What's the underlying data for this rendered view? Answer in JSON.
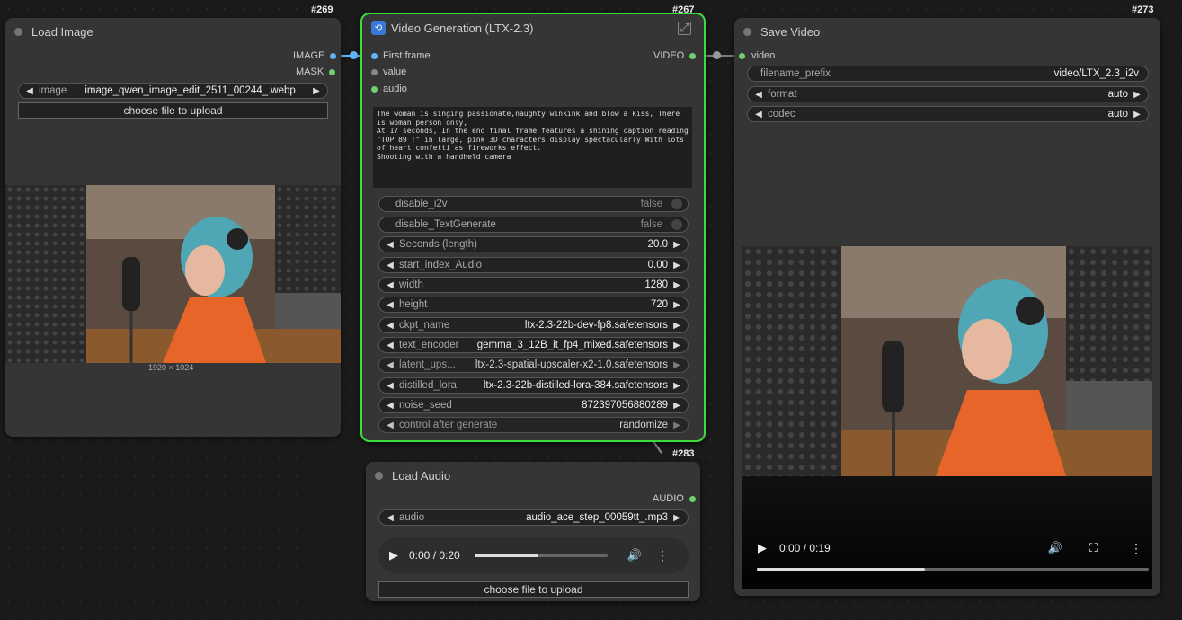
{
  "load_image": {
    "title": "Load Image",
    "id": "#269",
    "outputs": [
      "IMAGE",
      "MASK"
    ],
    "image_widget": {
      "label": "image",
      "value": "image_qwen_image_edit_2511_00244_.webp"
    },
    "upload_label": "choose file to upload",
    "dimensions": "1920 × 1024"
  },
  "video_gen": {
    "title": "Video Generation (LTX-2.3)",
    "id": "#267",
    "inputs": [
      "First frame",
      "value",
      "audio"
    ],
    "output": "VIDEO",
    "prompt": "The woman is singing passionate,naughty winkink and blow a kiss, There is woman person only,\nAt 17 seconds, In the end final frame features a shining caption reading \"TOP 89 !\" in large, pink 3D characters display spectacularly With lots of heart confetti as fireworks effect.\nShooting with a handheld camera",
    "toggles": [
      {
        "label": "disable_i2v",
        "value": "false"
      },
      {
        "label": "disable_TextGenerate",
        "value": "false"
      }
    ],
    "widgets": [
      {
        "label": "Seconds (length)",
        "value": "20.0"
      },
      {
        "label": "start_index_Audio",
        "value": "0.00"
      },
      {
        "label": "width",
        "value": "1280"
      },
      {
        "label": "height",
        "value": "720"
      },
      {
        "label": "ckpt_name",
        "value": "ltx-2.3-22b-dev-fp8.safetensors"
      },
      {
        "label": "text_encoder",
        "value": "gemma_3_12B_it_fp4_mixed.safetensors"
      },
      {
        "label": "latent_ups...",
        "value": "ltx-2.3-spatial-upscaler-x2-1.0.safetensors"
      },
      {
        "label": "distilled_lora",
        "value": "ltx-2.3-22b-distilled-lora-384.safetensors"
      },
      {
        "label": "noise_seed",
        "value": "872397056880289"
      },
      {
        "label": "control after generate",
        "value": "randomize"
      }
    ]
  },
  "save_video": {
    "title": "Save Video",
    "id": "#273",
    "input": "video",
    "widgets": [
      {
        "label": "filename_prefix",
        "value": "video/LTX_2.3_i2v"
      },
      {
        "label": "format",
        "value": "auto"
      },
      {
        "label": "codec",
        "value": "auto"
      }
    ],
    "player_time": "0:00 / 0:19",
    "player_progress": 0.43
  },
  "load_audio": {
    "title": "Load Audio",
    "id": "#283",
    "output": "AUDIO",
    "audio_widget": {
      "label": "audio",
      "value": "audio_ace_step_00059tt_.mp3"
    },
    "player_time": "0:00 / 0:20",
    "player_progress": 0.48,
    "upload_label": "choose file to upload"
  },
  "colors": {
    "accent_green": "#3ddc3d",
    "image_slot": "#64b5f6",
    "generic_slot": "#6fcf6f"
  }
}
